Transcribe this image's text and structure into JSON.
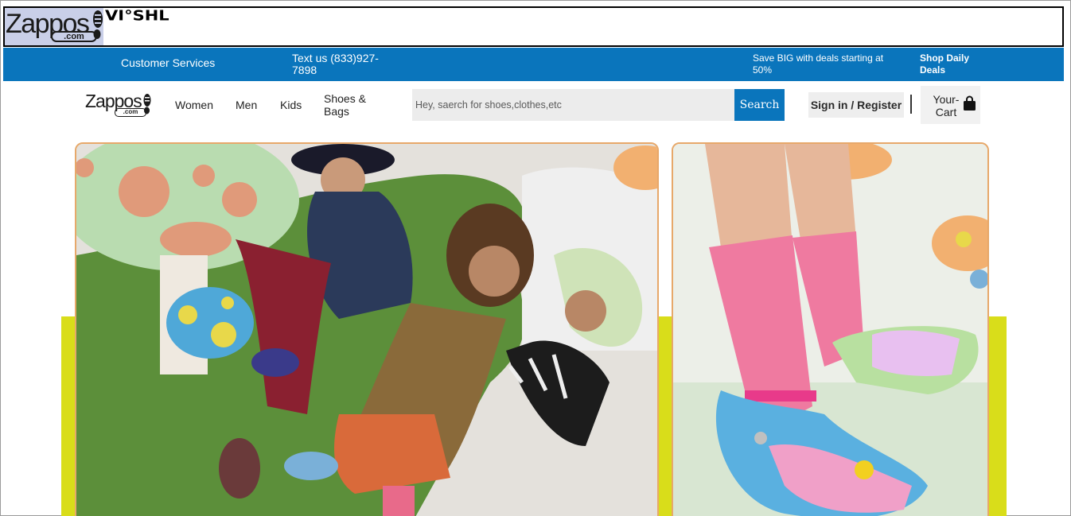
{
  "brand": {
    "logo_text": "Zappos",
    "logo_suffix": ".com",
    "partner_logo": "VI°SHL"
  },
  "topbar": {
    "customer_services": "Customer Services",
    "text_us": "Text us (833)927-7898",
    "save_big": "Save BIG with deals starting at 50%",
    "shop_deals": "Shop Daily Deals",
    "color": "#0a75bc"
  },
  "nav": {
    "items": [
      {
        "label": "Women"
      },
      {
        "label": "Men"
      },
      {
        "label": "Kids"
      },
      {
        "label": "Shoes & Bags"
      }
    ],
    "search": {
      "placeholder": "Hey, saerch for shoes,clothes,etc",
      "button_label": "Search"
    },
    "signin_label": "Sign in / Register",
    "cart_label": "Your-Cart",
    "cart_icon": "shopping-bag-icon"
  },
  "hero": {
    "accent_colors": [
      "#d9dd1a",
      "#e7a86a"
    ]
  }
}
